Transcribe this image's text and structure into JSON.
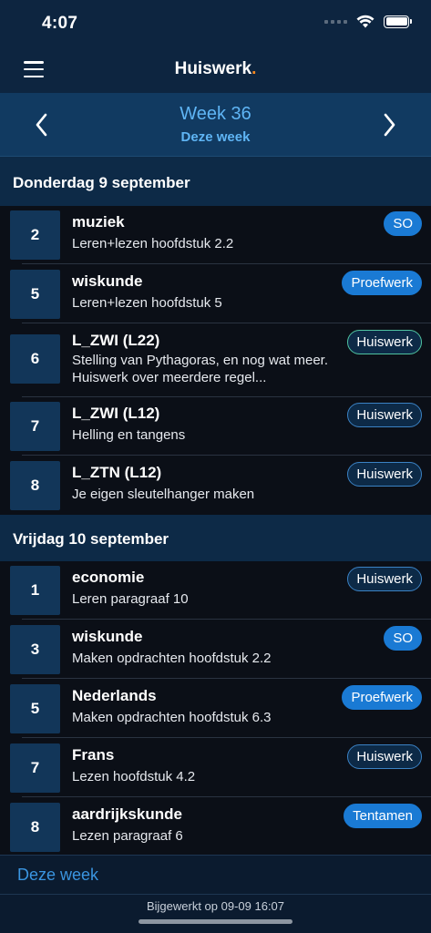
{
  "status": {
    "time": "4:07"
  },
  "header": {
    "title": "Huiswerk",
    "title_dot": "."
  },
  "week": {
    "title": "Week 36",
    "subtitle": "Deze week"
  },
  "days": [
    {
      "label": "Donderdag 9 september",
      "items": [
        {
          "period": "2",
          "subject": "muziek",
          "description": "Leren+lezen hoofdstuk 2.2",
          "badge": "SO",
          "badge_style": "solid"
        },
        {
          "period": "5",
          "subject": "wiskunde",
          "description": "Leren+lezen hoofdstuk 5",
          "badge": "Proefwerk",
          "badge_style": "solid"
        },
        {
          "period": "6",
          "subject": "L_ZWI (L22)",
          "description": "Stelling van Pythagoras, en nog wat meer. Huiswerk over meerdere regel...",
          "badge": "Huiswerk",
          "badge_style": "outline-green"
        },
        {
          "period": "7",
          "subject": "L_ZWI (L12)",
          "description": "Helling en tangens",
          "badge": "Huiswerk",
          "badge_style": "outline"
        },
        {
          "period": "8",
          "subject": "L_ZTN (L12)",
          "description": "Je eigen sleutelhanger maken",
          "badge": "Huiswerk",
          "badge_style": "outline"
        }
      ]
    },
    {
      "label": "Vrijdag 10 september",
      "items": [
        {
          "period": "1",
          "subject": "economie",
          "description": "Leren paragraaf 10",
          "badge": "Huiswerk",
          "badge_style": "outline"
        },
        {
          "period": "3",
          "subject": "wiskunde",
          "description": "Maken opdrachten hoofdstuk 2.2",
          "badge": "SO",
          "badge_style": "solid"
        },
        {
          "period": "5",
          "subject": "Nederlands",
          "description": "Maken opdrachten hoofdstuk 6.3",
          "badge": "Proefwerk",
          "badge_style": "solid"
        },
        {
          "period": "7",
          "subject": "Frans",
          "description": "Lezen hoofdstuk 4.2",
          "badge": "Huiswerk",
          "badge_style": "outline"
        },
        {
          "period": "8",
          "subject": "aardrijkskunde",
          "description": "Lezen paragraaf 6",
          "badge": "Tentamen",
          "badge_style": "solid"
        }
      ]
    }
  ],
  "footer": {
    "week_link": "Deze week",
    "updated": "Bijgewerkt op 09-09 16:07"
  },
  "colors": {
    "accent": "#5fb5f5",
    "brand_dot": "#ff8a1e",
    "badge_solid": "#1a7ad4"
  }
}
